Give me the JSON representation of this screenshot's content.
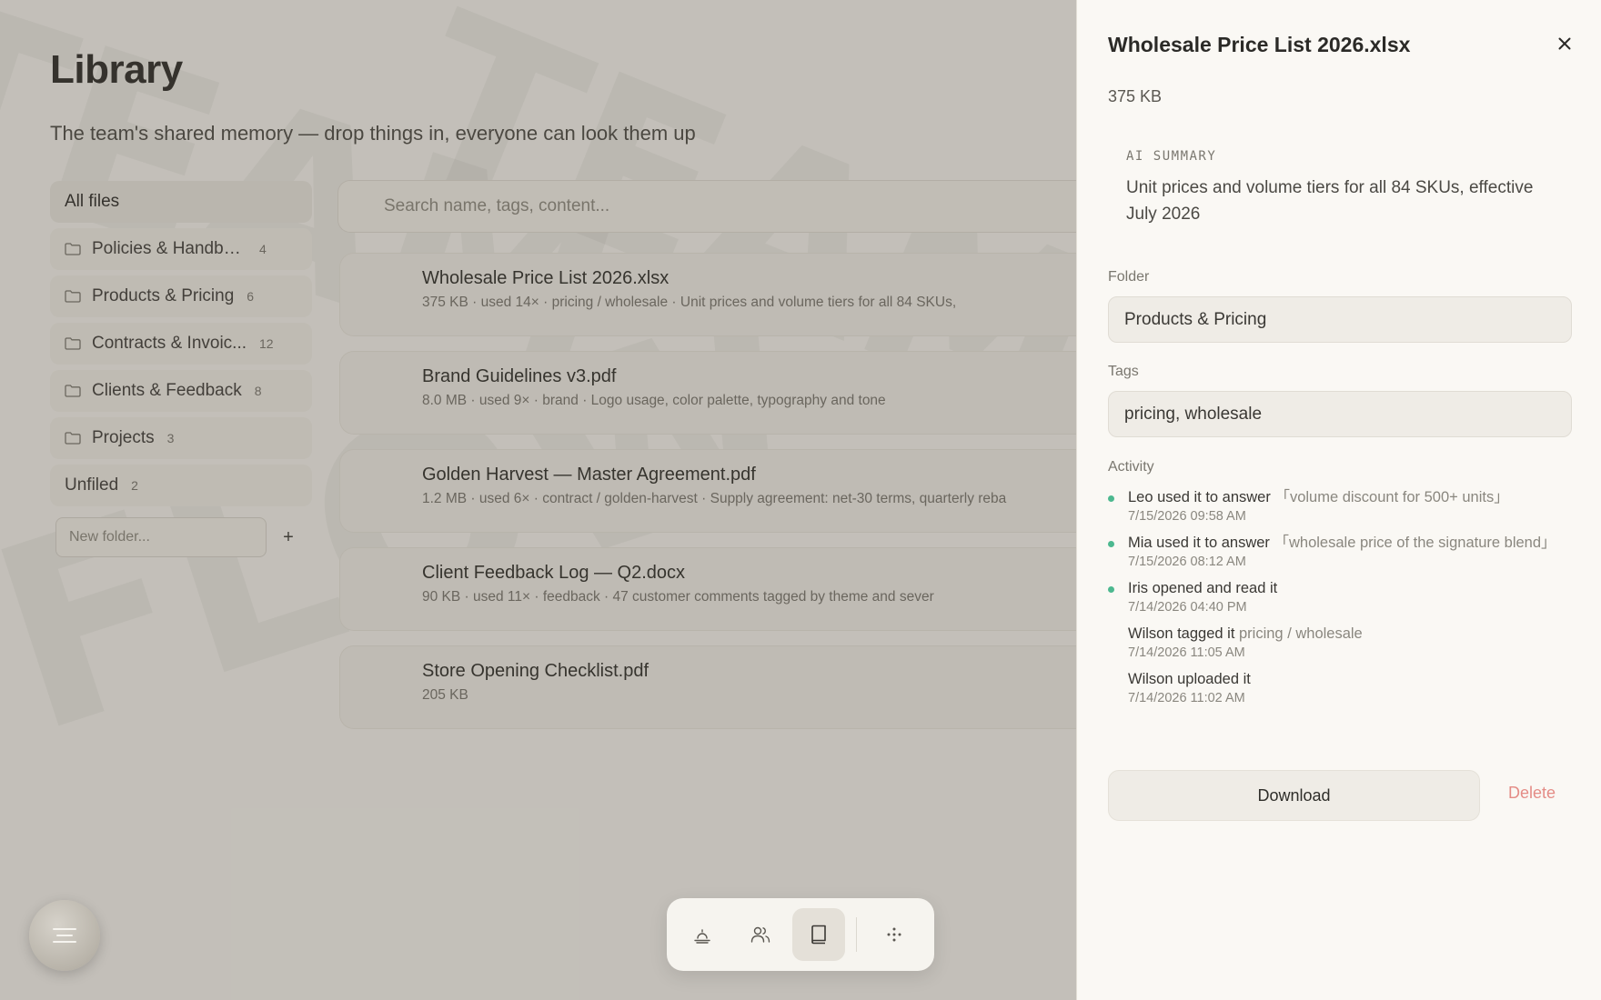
{
  "library": {
    "title": "Library",
    "subtitle": "The team's shared memory — drop things in, everyone can look them up",
    "watermark_words": [
      "TEAM",
      "FLOW",
      "TEAM"
    ]
  },
  "folders": {
    "all_label": "All files",
    "items": [
      {
        "label": "Policies & Handbook",
        "count": "4"
      },
      {
        "label": "Products & Pricing",
        "count": "6"
      },
      {
        "label": "Contracts & Invoic...",
        "count": "12"
      },
      {
        "label": "Clients & Feedback",
        "count": "8"
      },
      {
        "label": "Projects",
        "count": "3"
      }
    ],
    "unfiled_label": "Unfiled",
    "unfiled_count": "2",
    "new_folder_placeholder": "New folder...",
    "add_label": "+"
  },
  "search": {
    "placeholder": "Search name, tags, content..."
  },
  "files": [
    {
      "name": "Wholesale Price List 2026.xlsx",
      "meta": "375 KB · used 14× · pricing / wholesale · Unit prices and volume tiers for all 84 SKUs,"
    },
    {
      "name": "Brand Guidelines v3.pdf",
      "meta": "8.0 MB · used 9× · brand · Logo usage, color palette, typography and tone"
    },
    {
      "name": "Golden Harvest — Master Agreement.pdf",
      "meta": "1.2 MB · used 6× · contract / golden-harvest · Supply agreement: net-30 terms, quarterly reba"
    },
    {
      "name": "Client Feedback Log — Q2.docx",
      "meta": "90 KB · used 11× · feedback · 47 customer comments tagged by theme and sever"
    },
    {
      "name": "Store Opening Checklist.pdf",
      "meta": "205 KB"
    }
  ],
  "detail": {
    "title": "Wholesale Price List 2026.xlsx",
    "size": "375 KB",
    "ai_label": "AI SUMMARY",
    "ai_summary": "Unit prices and volume tiers for all 84 SKUs, effective July 2026",
    "folder_label": "Folder",
    "folder_value": "Products & Pricing",
    "tags_label": "Tags",
    "tags_value": "pricing, wholesale",
    "activity_label": "Activity",
    "activity": [
      {
        "actor": "Leo",
        "action": " used it to answer ",
        "detail": "「volume discount for 500+ units」",
        "time": "7/15/2026 09:58 AM",
        "dot": true
      },
      {
        "actor": "Mia",
        "action": " used it to answer ",
        "detail": "「wholesale price of the signature blend」",
        "time": "7/15/2026 08:12 AM",
        "dot": true
      },
      {
        "actor": "Iris",
        "action": " opened and read it",
        "detail": "",
        "time": "7/14/2026 04:40 PM",
        "dot": true
      },
      {
        "actor": "Wilson",
        "action": " tagged it ",
        "detail": "pricing / wholesale",
        "time": "7/14/2026 11:05 AM",
        "dot": false
      },
      {
        "actor": "Wilson",
        "action": " uploaded it",
        "detail": "",
        "time": "7/14/2026 11:02 AM",
        "dot": false
      }
    ],
    "download_label": "Download",
    "delete_label": "Delete"
  },
  "colors": {
    "accent_dot": "#4cb88f",
    "delete": "#e48c86",
    "panel_bg": "#faf8f4"
  },
  "icons": {
    "folder": "folder-icon",
    "close": "close-icon",
    "menu": "menu-icon",
    "dock": [
      "sunrise-icon",
      "people-icon",
      "book-icon",
      "move-icon"
    ]
  }
}
